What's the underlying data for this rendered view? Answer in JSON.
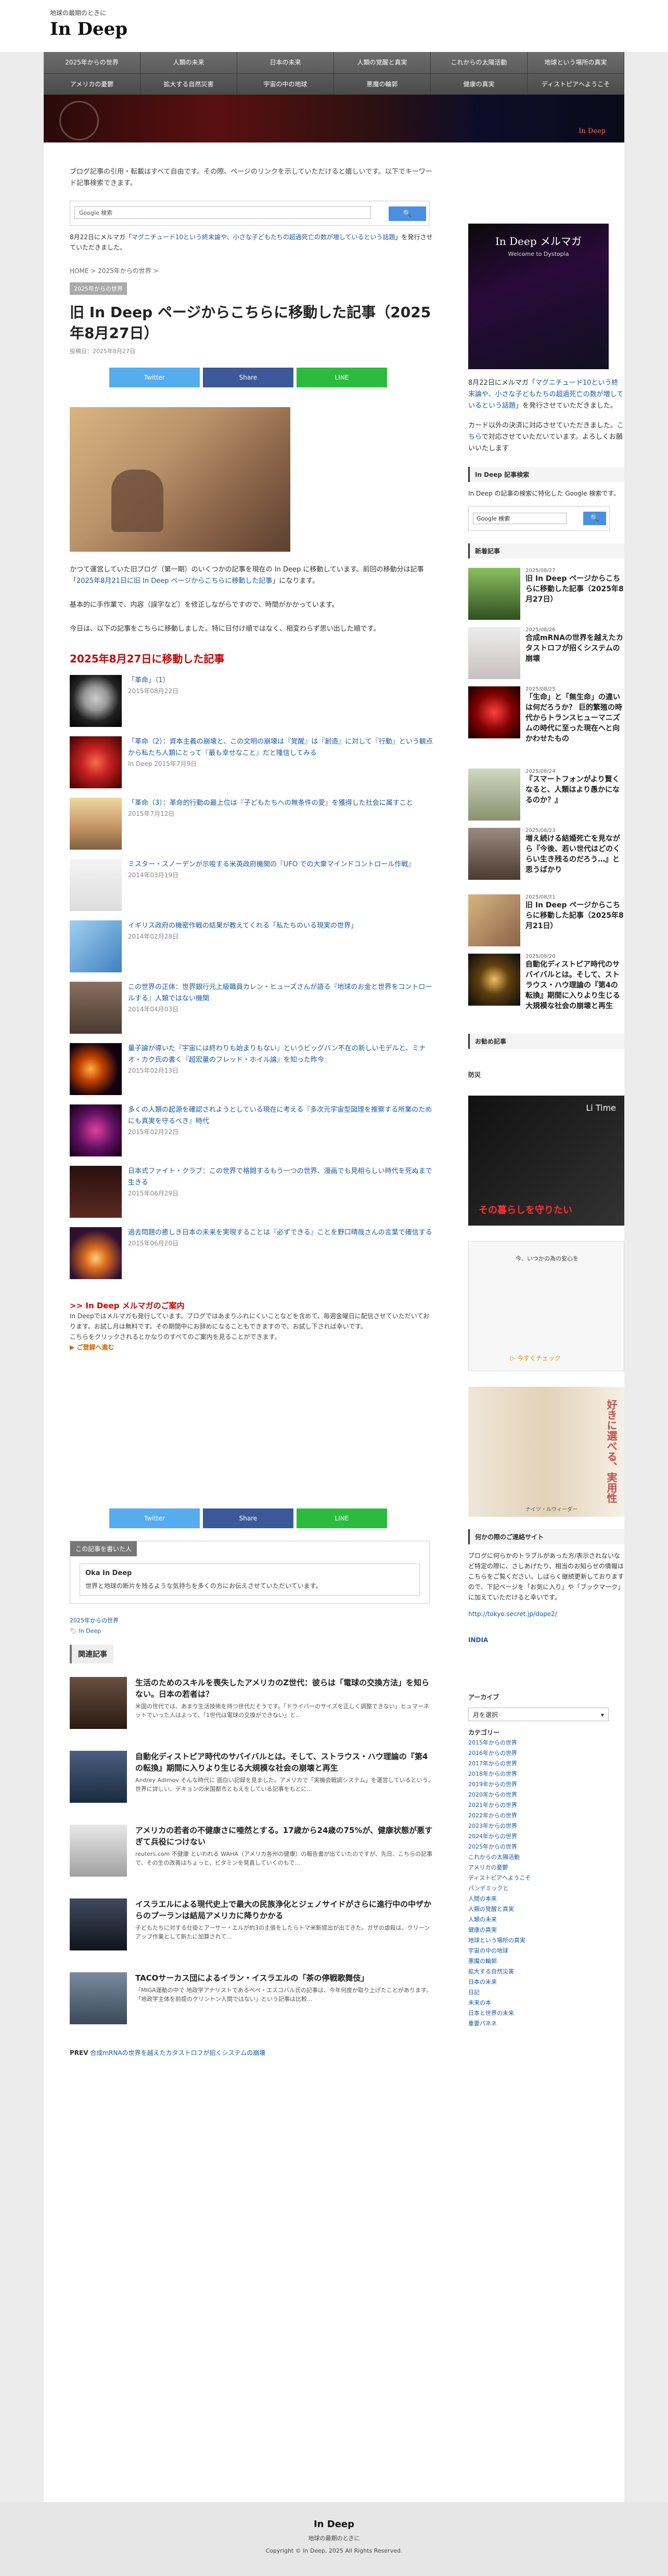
{
  "site": {
    "subtitle": "地球の最期のときに",
    "title": "In Deep"
  },
  "nav": {
    "row1": [
      "2025年からの世界",
      "人類の未来",
      "日本の未来",
      "人類の覚醒と真実",
      "これからの太陽活動",
      "地球という場所の真実"
    ],
    "row2": [
      "アメリカの憂鬱",
      "拡大する自然災害",
      "宇宙の中の地球",
      "悪魔の輪郭",
      "健康の真実",
      "ディストピアへようこそ"
    ]
  },
  "banner": {
    "text": "In Deep"
  },
  "intro": "ブログ記事の引用・転載はすべて自由です。その際、ページのリンクを示していただけると嬉しいです。以下でキーワード記事検索できます。",
  "gsearch": {
    "placeholder": "Google 検索",
    "button": "🔍"
  },
  "notice": {
    "prefix": "8月22日にメルマガ「",
    "link": "マグニチュード10という終末論や、小さな子どもたちの超過死亡の数が増しているという話題",
    "suffix": "」を発行させていただきました。"
  },
  "breadcrumb": "HOME > 2025年からの世界 >",
  "category": "2025年からの世界",
  "post": {
    "title": "旧 In Deep ページからこちらに移動した記事（2025年8月27日）",
    "date": "投稿日：2025年8月27日"
  },
  "share": {
    "twitter": "Twitter",
    "facebook": "Share",
    "line": "LINE"
  },
  "body": {
    "p1a": "かつて運営していた旧ブログ（第一期）のいくつかの記事を現在の In Deep に移動しています。前回の移動分は記事「",
    "p1link": "2025年8月21日に旧 In Deep ページからこちらに移動した記事",
    "p1b": "」になります。",
    "p2": "基本的に手作業で、内容（誤字など）を修正しながらですので、時間がかかっています。",
    "p3": "今日は、以下の記事をこちらに移動しました。特に日付け順ではなく、相変わらず思い出した順です。",
    "section": "2025年8月27日に移動した記事"
  },
  "moved": [
    {
      "title": "「革命」（1）",
      "date": "2015年08月22日"
    },
    {
      "title": "「革命（2）：資本主義の崩壊と、この文明の崩壊は『覚醒』は『創造』に対して『行動』という観点から私たち人類にとって『最も幸せなこと』だと隆信してみる",
      "date": "In Deep 2015年7月9日"
    },
    {
      "title": "「革命（3）：革命的行動の最上位は『子どもたちへの無条件の愛』を獲得した社会に属すこと",
      "date": "2015年7月12日"
    },
    {
      "title": "ミスター・スノーデンが示唆する米英政府機関の『UFO での大衆マインドコントロール作戦』",
      "date": "2014年03月19日"
    },
    {
      "title": "イギリス政府の機密作戦の結果が教えてくれる「私たちのいる現実の世界」",
      "date": "2014年02月28日"
    },
    {
      "title": "この世界の正体：世界銀行元上級職員カレン・ヒューズさんが語る『地球のお金と世界をコントロールする』人類ではない機関",
      "date": "2014年04月03日"
    },
    {
      "title": "量子論が導いた『宇宙には終わりも始まりもない』というビッグバン不在の新しいモデルと、ミナオ・カク氏の書く『超宏量のフレッド・ホイル論』を知った昨今",
      "date": "2015年02月13日"
    },
    {
      "title": "多くの人類の起源を確認されようとしている現在に考える『多次元宇宙型図理を推察する所業のためにも真実を守るべき』時代",
      "date": "2015年02月22日"
    },
    {
      "title": "日本式ファイト・クラブ：この世界で格闘するもう一つの世界、漫画でも見相らしい時代を死ぬまで生きる",
      "date": "2015年06月29日"
    },
    {
      "title": "過去問題の癒しき日本の未来を実現することは『必ずできる』ことを野口晴哉さんの言葉で確信する",
      "date": "2015年06月20日"
    }
  ],
  "magazine": {
    "title": ">> In Deep メルマガのご案内",
    "text": "In Deepではメルマガも発行しています。ブログではあまりふれにくいことなどを含めて、毎週金曜日に配信させていただいております。お試し月は無料です。その期間中にお辞めになることもできますので、お試し下されば幸いです。",
    "link": "こちらをクリックされるとかなりのすべてのご案内を見ることができます。",
    "cta": "▶ ご登録へ進む"
  },
  "write": {
    "head": "この記事を書いた人",
    "name": "Oka In Deep",
    "desc": "世界と地球の断片を残るような気持ちを多くの方にお伝えさせていただいています。"
  },
  "meta": {
    "cat": "2025年からの世界",
    "tag": "In Deep"
  },
  "related": {
    "heading": "関連記事",
    "items": [
      {
        "title": "生活のためのスキルを喪失したアメリカのZ世代：彼らは「電球の交換方法」を知らない。日本の若者は？",
        "ex": "米国の世代では、あまり生活技術を持つ世代だそうです。「ドライバーのサイズを正しく調整できない」ヒュマーネットでいった人はよって、「1世代は電球の交換ができない」と..."
      },
      {
        "title": "自動化ディストピア時代のサバイバルとは。そして、ストラウス・ハウ理論の『第4の転換』期間に入りより生じる大規模な社会の崩壊と再生",
        "ex": "Andrey Adimov そんな時代に 面白い記録を見ました。アメリカで「実機会戦調システム」を運営しているという、世界に詳しい、デキョンの米国都市ともえをしている記事をもとに..."
      },
      {
        "title": "アメリカの若者の不健康さに唖然とする。17歳から24歳の75%が、健康状態が悪すぎて兵役につけない",
        "ex": "reuters.com 不健康 といわれる WAHA（アメリカ各州の健康）の報告書が出ていたのですが、先日、こちらの記事で、その生の改善はちょっと、ビタミンを見直していくのもで..."
      },
      {
        "title": "イスラエルによる現代史上で最大の民族浄化とジェノサイドがさらに進行中の中ザからのプーランは結局アメリカに降りかかる",
        "ex": "子どもたちに対する仕掛とアーサー・エルが約3の主張をしたらトマ米新提出が出てきた。ガザの虐殺は、クリーンアップ作業として新たに加算されて..."
      },
      {
        "title": "TACOサーカス団によるイラン・イスラエルの「茶の停戦歌舞伎」",
        "ex": "「MIGA運動の中で 地政学アナリストであるペペ・エスコバル氏の記事は、今年何度か取り上げたことがあります。「地政学主体を前提のクリントン人間ではない」という記事は比較..."
      }
    ]
  },
  "prev": {
    "label": "PREV",
    "link": "合成mRNAの世界を越えたカタストロフが招くシステムの崩壊"
  },
  "sidebar": {
    "mag_img_title": "In Deep メルマガ",
    "mag_img_sub": "Welcome to Dystopia",
    "mag_text_a": "8月22日にメルマガ「",
    "mag_text_link": "マグニチュード10という終末論や、小さな子どもたちの超過死亡の数が増しているという話題",
    "mag_text_b": "」を発行させていただきました。",
    "card": "カード以外の決済に対応させていただきました。",
    "card_link": "こちら",
    "card_b": "で対応させていただいています。よろしくお願いいたします",
    "search_h": "In Deep 記事検索",
    "search_desc": "In Deep の記事の検索に特化した Google 検索です。",
    "search_ph": "Google 検索",
    "new_h": "新着記事",
    "new_items": [
      {
        "date": "2025/08/27",
        "title": "旧 In Deep ページからこちらに移動した記事（2025年8月27日）"
      },
      {
        "date": "2025/08/26",
        "title": "合成mRNAの世界を越えたカタストロフが招くシステムの崩壊"
      },
      {
        "date": "2025/08/25",
        "title": "「生命」と「無生命」の違いは何だろうか？ 巨的繁殖の時代からトランスヒューマニズムの時代に至った現在へと向かわせたもの"
      },
      {
        "date": "2025/08/24",
        "title": "『スマートフォンがより賢くなると、人類はより愚かになるのか？』"
      },
      {
        "date": "2025/08/23",
        "title": "増え続ける結婚死亡を見ながら『今後、若い世代はどのくらい生き残るのだろう…』と思うばかり"
      },
      {
        "date": "2025/08/21",
        "title": "旧 In Deep ページからこちらに移動した記事（2025年8月21日）"
      },
      {
        "date": "2025/08/20",
        "title": "自動化ディストピア時代のサバイバルとは。そして、ストラウス・ハウ理論の『第4の転換』期間に入りより生じる大規模な社会の崩壊と再生"
      }
    ],
    "recommend_h": "お勧め記事",
    "ad_h": "防災",
    "ad1_logo": "Li Time",
    "ad1_text": "その暮らしを守りたい",
    "ad2_text": "今、いつかの為の安心を",
    "ad2_cta": "▷ 今すぐチェック",
    "ad3_text": "好きに選べる、実用性",
    "ad3_brand": "ナイツ・ルウィーダー",
    "link_h": "何かの際のご連絡サイト",
    "link_text": "ブログに何らかのトラブルがあった方/表示されないなど特定の際に、さしあげたり、相当のお知らせの情報はこちらをご覧ください。しばらく継続更新しておりますので、下記ページを「お気に入り」や「ブックマーク」に加えていただけると幸いです。",
    "link_url": "http://tokyo.secret.jp/dope2/",
    "link_name": "INDIA",
    "archive_h": "アーカイブ",
    "archive_select": "月を選択",
    "category_h": "カテゴリー",
    "categories": [
      "2015年からの世界",
      "2016年からの世界",
      "2017年からの世界",
      "2018年からの世界",
      "2019年からの世界",
      "2020年からの世界",
      "2021年からの世界",
      "2022年からの世界",
      "2023年からの世界",
      "2024年からの世界",
      "2025年からの世界",
      "これからの太陽活動",
      "アメリカの憂鬱",
      "ディストピアへようこそ",
      "パンデミックと",
      "人間の本来",
      "人類の覚醒と真実",
      "人類の未来",
      "健康の真実",
      "地球という場所の真実",
      "宇宙の中の地球",
      "悪魔の輪郭",
      "拡大する自然災害",
      "日本の未来",
      "日記",
      "未来の本",
      "日本と世界の未来",
      "重要パネネ"
    ]
  },
  "footer": {
    "title": "In Deep",
    "sub": "地球の最期のときに",
    "copy": "Copyright © In Deep, 2025 All Rights Reserved."
  }
}
